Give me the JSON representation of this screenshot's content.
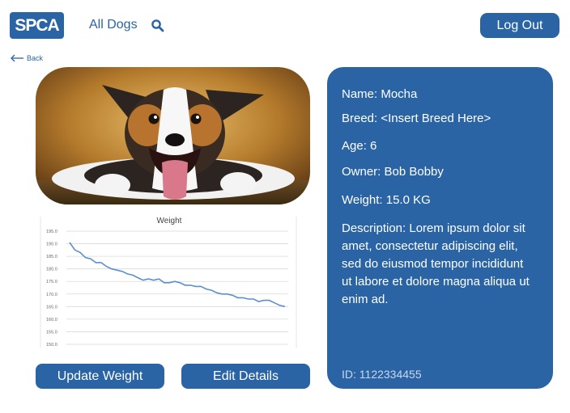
{
  "header": {
    "logo_text": "SPCA",
    "nav_link": "All Dogs",
    "logout_label": "Log Out",
    "accent": "#2a64a4"
  },
  "back_label": "Back",
  "chart_data": {
    "type": "line",
    "title": "Weight",
    "ylim": [
      150.0,
      195.0
    ],
    "yticks": [
      "195.0",
      "190.0",
      "185.0",
      "180.0",
      "175.0",
      "170.0",
      "165.0",
      "160.0",
      "155.0",
      "150.0"
    ],
    "series": [
      {
        "values": [
          190.5,
          187.5,
          186.5,
          184.5,
          184.0,
          182.5,
          182.5,
          181.0,
          180.0,
          179.5,
          179.0,
          178.0,
          177.5,
          176.5,
          175.5,
          176.0,
          175.5,
          176.0,
          174.5,
          174.5,
          175.0,
          174.5,
          173.5,
          173.5,
          173.0,
          173.0,
          172.0,
          171.5,
          170.5,
          170.0,
          170.0,
          169.5,
          168.5,
          168.5,
          168.0,
          168.0,
          167.0,
          167.5,
          167.5,
          166.5,
          165.5,
          165.0
        ]
      }
    ]
  },
  "buttons": {
    "update_weight": "Update Weight",
    "edit_details": "Edit Details"
  },
  "dog": {
    "name": "Name: Mocha",
    "breed": "Breed: <Insert Breed Here>",
    "age": "Age: 6",
    "owner": "Owner: Bob Bobby",
    "weight": "Weight: 15.0 KG",
    "description": "Description: Lorem ipsum dolor sit amet, consectetur adipiscing elit, sed do eiusmod tempor incididunt ut labore et dolore magna aliqua ut enim ad.",
    "id": "ID: 1122334455"
  }
}
